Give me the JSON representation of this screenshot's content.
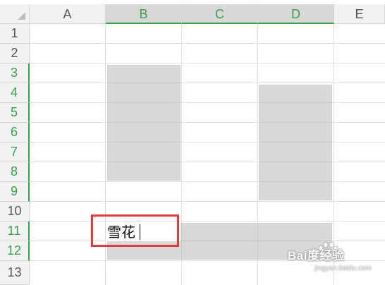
{
  "columns": [
    {
      "label": "A",
      "selected": false
    },
    {
      "label": "B",
      "selected": true
    },
    {
      "label": "C",
      "selected": true
    },
    {
      "label": "D",
      "selected": true
    },
    {
      "label": "E",
      "selected": false
    }
  ],
  "rows": [
    {
      "label": "1",
      "selected": false
    },
    {
      "label": "2",
      "selected": false
    },
    {
      "label": "3",
      "selected": true
    },
    {
      "label": "4",
      "selected": true
    },
    {
      "label": "5",
      "selected": true
    },
    {
      "label": "6",
      "selected": true
    },
    {
      "label": "7",
      "selected": true
    },
    {
      "label": "8",
      "selected": true
    },
    {
      "label": "9",
      "selected": true
    },
    {
      "label": "10",
      "selected": false
    },
    {
      "label": "11",
      "selected": true
    },
    {
      "label": "12",
      "selected": true
    },
    {
      "label": "13",
      "selected": false
    }
  ],
  "editing": {
    "cell": "B11",
    "text": "雪花"
  },
  "watermark": {
    "logo_text": "Bai度经验",
    "url": "jingyan.baidu.com"
  },
  "colors": {
    "accent": "#3aa04a",
    "selection_fill": "#d9d9d9",
    "highlight_box": "#e23b3b"
  }
}
